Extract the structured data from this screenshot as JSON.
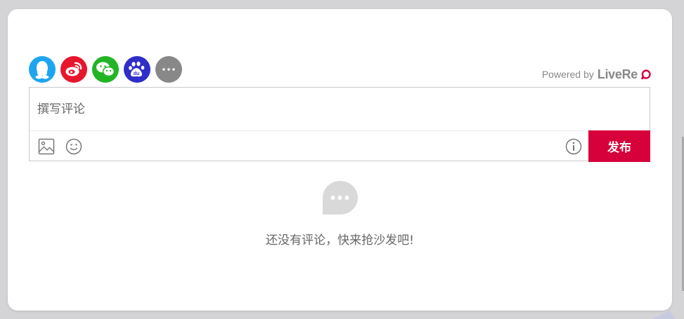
{
  "social": [
    {
      "id": "qq",
      "icon": "qq-penguin-icon",
      "color": "#1ea5f0"
    },
    {
      "id": "weibo",
      "icon": "weibo-icon",
      "color": "#e6162d"
    },
    {
      "id": "wechat",
      "icon": "wechat-icon",
      "color": "#22b424"
    },
    {
      "id": "baidu",
      "icon": "baidu-paw-icon",
      "color": "#2f2ec9"
    },
    {
      "id": "more",
      "icon": "more-dots-icon",
      "color": "#888888"
    }
  ],
  "powered": {
    "text": "Powered by",
    "brand": "LiveRe"
  },
  "composer": {
    "placeholder": "撰写评论",
    "image_icon": "image-icon",
    "emoji_icon": "emoji-icon",
    "info_icon": "info-icon",
    "submit_label": "发布",
    "submit_color": "#d6003a"
  },
  "empty_state": {
    "icon": "speech-bubble-icon",
    "text": "还没有评论，快来抢沙发吧!"
  }
}
